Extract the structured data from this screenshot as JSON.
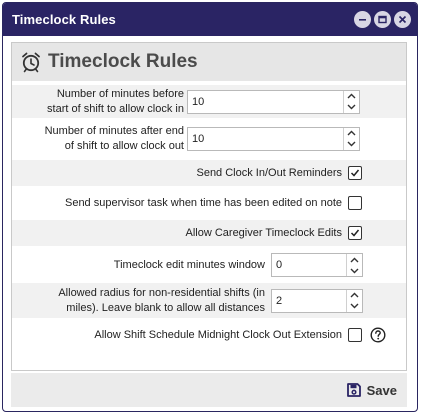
{
  "window": {
    "title": "Timeclock Rules",
    "controls": [
      "minimize-icon",
      "maximize-icon",
      "close-icon"
    ]
  },
  "panel": {
    "title": "Timeclock Rules",
    "icon": "alarm-clock-icon"
  },
  "fields": {
    "minutes_before": {
      "label_line1": "Number of minutes before",
      "label_line2": "start of shift to allow clock in",
      "value": "10"
    },
    "minutes_after": {
      "label_line1": "Number of minutes after end",
      "label_line2": "of shift to allow clock out",
      "value": "10"
    },
    "send_reminders": {
      "label": "Send Clock In/Out Reminders",
      "checked": true
    },
    "supervisor_task": {
      "label": "Send supervisor task when time has been edited on note",
      "checked": false
    },
    "caregiver_edits": {
      "label": "Allow Caregiver Timeclock Edits",
      "checked": true
    },
    "edit_window": {
      "label": "Timeclock edit minutes window",
      "value": "0"
    },
    "radius": {
      "label_line1": "Allowed radius for non-residential shifts (in",
      "label_line2": "miles). Leave blank to allow all distances",
      "value": "2"
    },
    "midnight_extension": {
      "label": "Allow Shift Schedule Midnight Clock Out Extension",
      "checked": false,
      "help_icon": "help-circle-icon"
    }
  },
  "footer": {
    "save_label": "Save",
    "save_icon": "floppy-disk-icon"
  }
}
